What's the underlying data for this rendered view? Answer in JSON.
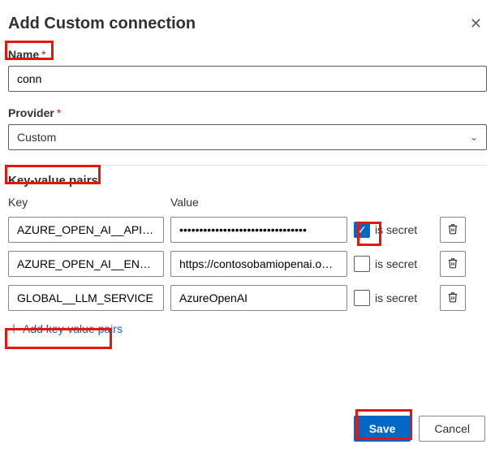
{
  "dialog": {
    "title": "Add Custom connection"
  },
  "fields": {
    "name_label": "Name",
    "name_value": "conn",
    "provider_label": "Provider",
    "provider_value": "Custom"
  },
  "kv": {
    "section_title": "Key-value pairs",
    "key_header": "Key",
    "value_header": "Value",
    "secret_label": "is secret",
    "add_link": "Add key-value pairs",
    "rows": [
      {
        "key": "AZURE_OPEN_AI__API_KEY",
        "value": "••••••••••••••••••••••••••••••••",
        "is_secret": true
      },
      {
        "key": "AZURE_OPEN_AI__ENDPOINT",
        "value": "https://contosobamiopenai.openai.azure.com/",
        "is_secret": false
      },
      {
        "key": "GLOBAL__LLM_SERVICE",
        "value": "AzureOpenAI",
        "is_secret": false
      }
    ]
  },
  "footer": {
    "save": "Save",
    "cancel": "Cancel"
  }
}
